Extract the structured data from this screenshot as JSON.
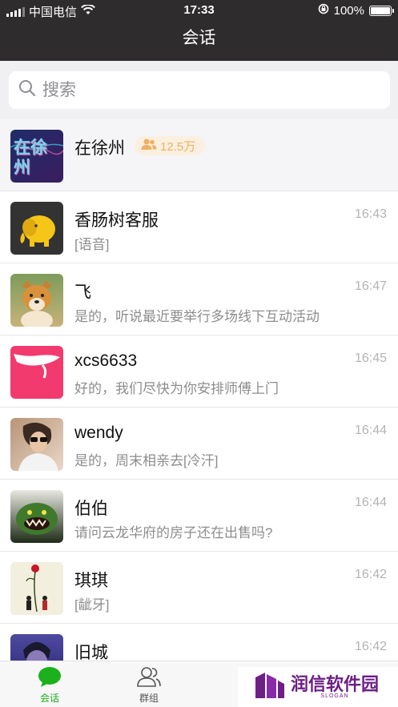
{
  "status": {
    "carrier": "中国电信",
    "time": "17:33",
    "battery": "100%"
  },
  "nav": {
    "title": "会话"
  },
  "search": {
    "placeholder": "搜索"
  },
  "group": {
    "name": "在徐州",
    "member_count": "12.5万",
    "avatar_text": "在徐州"
  },
  "conversations": [
    {
      "name": "香肠树客服",
      "message": "[语音]",
      "time": "16:43",
      "avatar": "elephant-avatar"
    },
    {
      "name": "飞",
      "message": "是的，听说最近要举行多场线下互动活动",
      "time": "16:47",
      "avatar": "dog-avatar"
    },
    {
      "name": "xcs6633",
      "message": "好的，我们尽快为你安排师傅上门",
      "time": "16:45",
      "avatar": "hand-avatar"
    },
    {
      "name": "wendy",
      "message": "是的，周末相亲去[冷汗]",
      "time": "16:44",
      "avatar": "woman-avatar"
    },
    {
      "name": "伯伯",
      "message": "请问云龙华府的房子还在出售吗?",
      "time": "16:44",
      "avatar": "monster-avatar"
    },
    {
      "name": "琪琪",
      "message": "[龇牙]",
      "time": "16:42",
      "avatar": "rose-avatar"
    },
    {
      "name": "旧城",
      "message": "",
      "time": "16:42",
      "avatar": "boy-avatar"
    }
  ],
  "tabs": [
    {
      "label": "会话",
      "icon": "chat-bubble-icon",
      "active": true
    },
    {
      "label": "群组",
      "icon": "group-icon",
      "active": false
    }
  ],
  "watermark": {
    "text": "润信软件园",
    "slogan": "SLOGAN"
  },
  "colors": {
    "bar": "#2e2c2d",
    "accent": "#1cb01c",
    "badge_bg": "#fbf0df",
    "badge_fg": "#f0b063"
  }
}
